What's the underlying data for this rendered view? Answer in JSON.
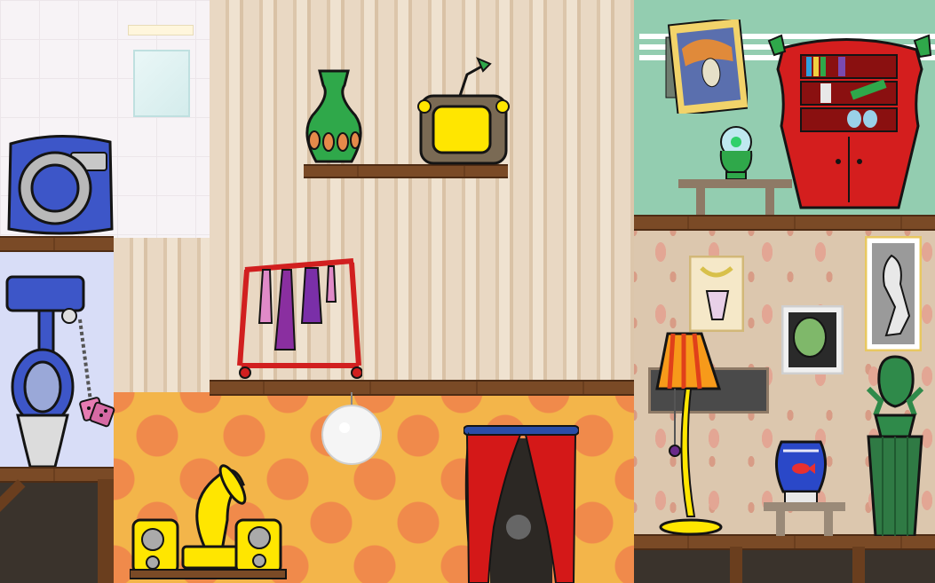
{
  "scene": {
    "rooms": [
      "bathroom",
      "living-room",
      "music-room",
      "library",
      "flamingo-room",
      "basement"
    ],
    "colors": {
      "wood": "#7a4a26",
      "stripe": "#e9d8c3",
      "polka_bg": "#f3b54a",
      "polka_dot": "#f08a4b",
      "mint_wall": "#93cdb0",
      "flamingo_wall": "#dcc7ae",
      "bathroom_tile": "#f7f3f6",
      "bathroom_lower": "#d8ddf7"
    }
  },
  "objects": {
    "top_left": [
      "washing-machine",
      "mirror",
      "light"
    ],
    "left_mid": [
      "toilet",
      "pull-chain",
      "fuzzy-dice"
    ],
    "center_top": [
      "green-vase",
      "retro-tv"
    ],
    "center_mid": [
      "clothes-rack"
    ],
    "center_bottom": [
      "disco-ball",
      "gramophone",
      "speakers",
      "red-curtain"
    ],
    "right_top": [
      "scream-painting",
      "crystal-ball",
      "side-table",
      "red-bookcase"
    ],
    "right_bottom": [
      "chain-painting",
      "alien-painting",
      "ninja-painting",
      "floor-lamp",
      "goldfish-bowl",
      "statue-bust"
    ]
  }
}
